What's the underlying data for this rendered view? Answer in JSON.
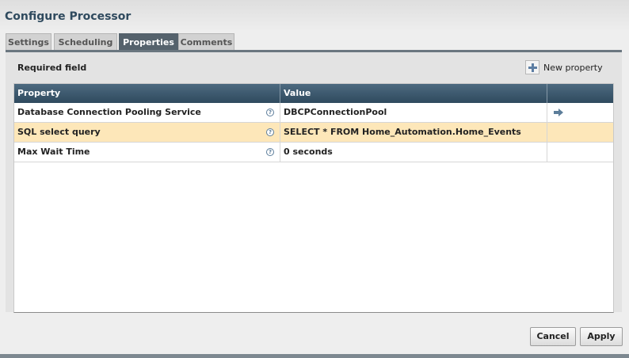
{
  "dialog": {
    "title": "Configure Processor"
  },
  "tabs": [
    {
      "label": "Settings",
      "active": false
    },
    {
      "label": "Scheduling",
      "active": false
    },
    {
      "label": "Properties",
      "active": true
    },
    {
      "label": "Comments",
      "active": false
    }
  ],
  "toolbar": {
    "required_label": "Required field",
    "new_property_label": "New property",
    "new_property_icon": "plus-icon"
  },
  "table": {
    "columns": [
      "Property",
      "Value",
      ""
    ],
    "rows": [
      {
        "property": "Database Connection Pooling Service",
        "value": "DBCPConnectionPool",
        "help_icon": "?",
        "action_icon": "goto-arrow-icon",
        "selected": false
      },
      {
        "property": "SQL select query",
        "value": "SELECT * FROM Home_Automation.Home_Events",
        "help_icon": "?",
        "action_icon": "",
        "selected": true
      },
      {
        "property": "Max Wait Time",
        "value": "0 seconds",
        "help_icon": "?",
        "action_icon": "",
        "selected": false
      }
    ]
  },
  "buttons": {
    "cancel": "Cancel",
    "apply": "Apply"
  },
  "colors": {
    "header": "#2f4a5e",
    "active_tab": "#55626c",
    "selected_row": "#fde7b9",
    "icon_blue": "#5c7d9a"
  }
}
